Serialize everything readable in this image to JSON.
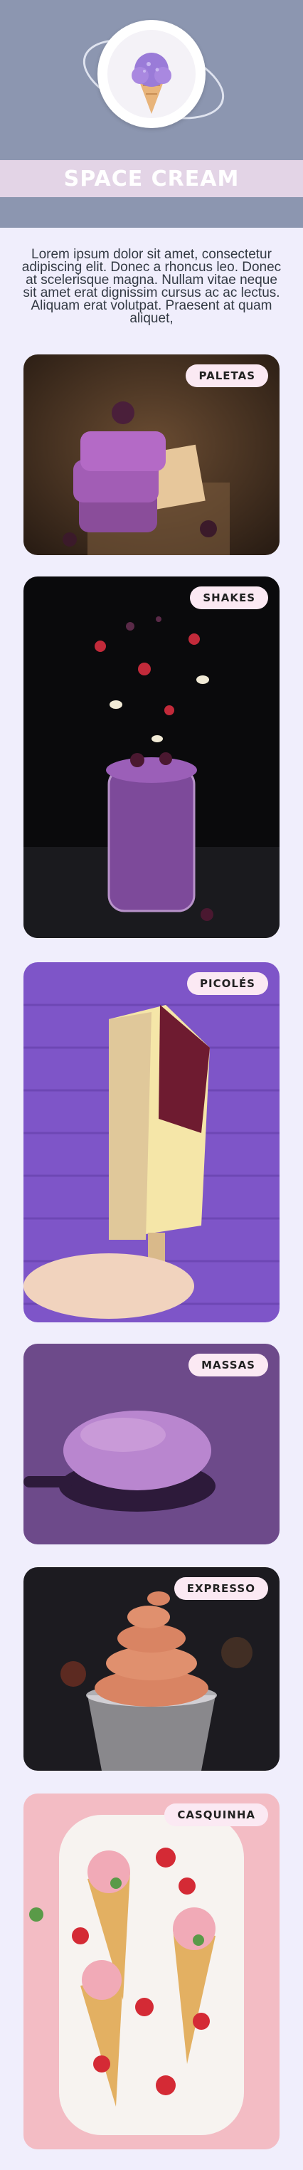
{
  "header": {
    "title": "SPACE CREAM",
    "logo_icon": "ice-cream-planet-icon",
    "background": "#8c96b0",
    "title_bar_color": "#e3d4e6"
  },
  "intro": {
    "text": "Lorem ipsum dolor sit amet, consectetur adipiscing elit. Donec a rhoncus leo. Donec at scelerisque magna. Nullam vitae neque sit amet erat dignissim cursus ac ac lectus. Aliquam erat volutpat. Praesent at quam aliquet,"
  },
  "products": [
    {
      "label": "PALETAS",
      "image": "stacked-popsicles-photo"
    },
    {
      "label": "SHAKES",
      "image": "berry-milkshake-photo"
    },
    {
      "label": "PICOLÉS",
      "image": "popsicle-in-hand-photo"
    },
    {
      "label": "MASSAS",
      "image": "ice-cream-scoop-photo"
    },
    {
      "label": "EXPRESSO",
      "image": "soft-serve-cup-photo"
    },
    {
      "label": "CASQUINHA",
      "image": "ice-cream-cones-photo"
    }
  ]
}
